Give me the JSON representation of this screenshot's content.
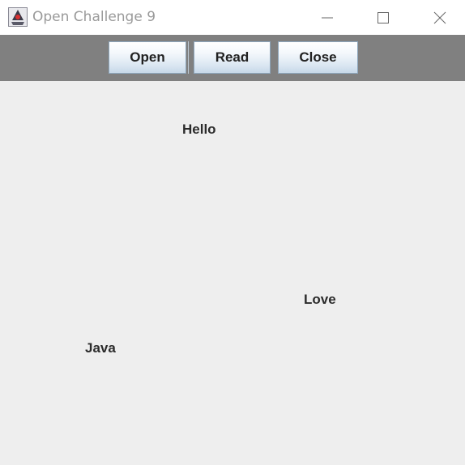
{
  "window": {
    "title": "Open Challenge 9",
    "icon": "java-duke-icon",
    "controls": [
      "minimize-icon",
      "maximize-icon",
      "close-icon"
    ]
  },
  "toolbar": {
    "open_label": "Open",
    "read_label": "Read",
    "close_label": "Close"
  },
  "canvas": {
    "words": [
      "Hello",
      "Love",
      "Java"
    ]
  },
  "colors": {
    "toolbar_bg": "#808080",
    "canvas_bg": "#eeeeee",
    "titlebar_bg": "#ffffff"
  }
}
